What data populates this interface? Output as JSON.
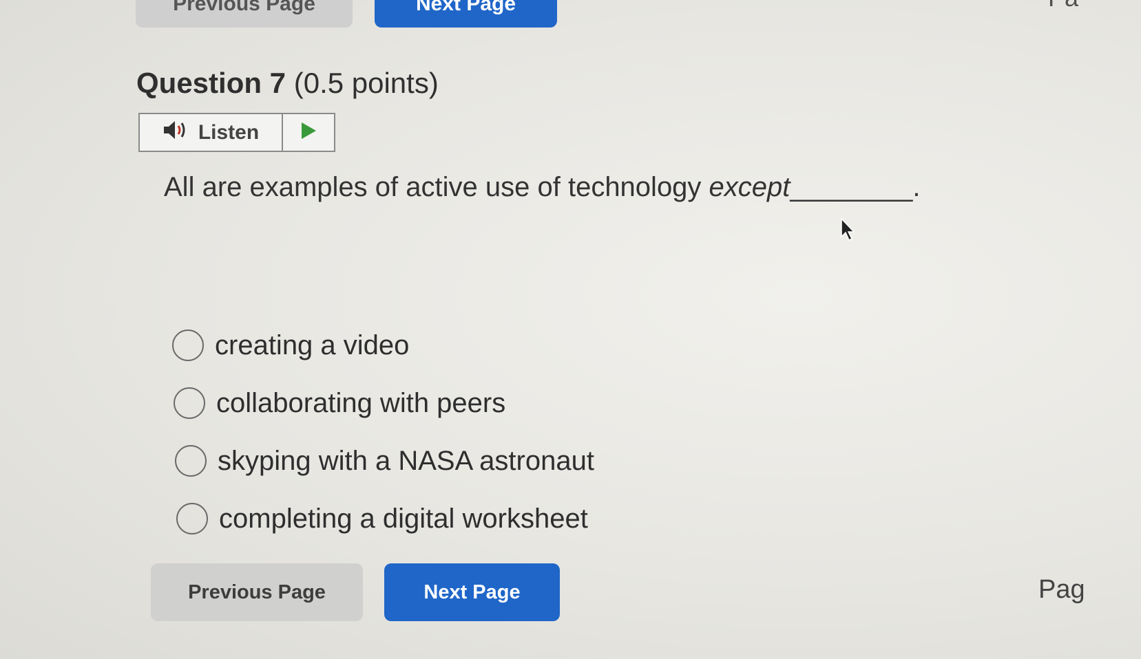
{
  "top_nav": {
    "previous_label": "Previous Page",
    "next_label": "Next Page",
    "right_fragment": "Pa"
  },
  "question": {
    "title": "Question 7",
    "points": "(0.5 points)",
    "prompt_main": "All are examples of active use of technology ",
    "prompt_emphasis": "except",
    "prompt_blank": "________."
  },
  "listen": {
    "label": "Listen",
    "icon": "speaker-icon",
    "play_icon": "play-icon",
    "play_color": "#3a9a3a"
  },
  "options": [
    {
      "label": "creating a video",
      "selected": false
    },
    {
      "label": "collaborating with peers",
      "selected": false
    },
    {
      "label": "skyping with a NASA astronaut",
      "selected": false
    },
    {
      "label": "completing a digital worksheet",
      "selected": false
    }
  ],
  "bottom_nav": {
    "previous_label": "Previous Page",
    "next_label": "Next Page",
    "page_fragment": "Pag"
  },
  "colors": {
    "primary_button": "#1f66c8",
    "secondary_button": "#d0d0ce"
  }
}
